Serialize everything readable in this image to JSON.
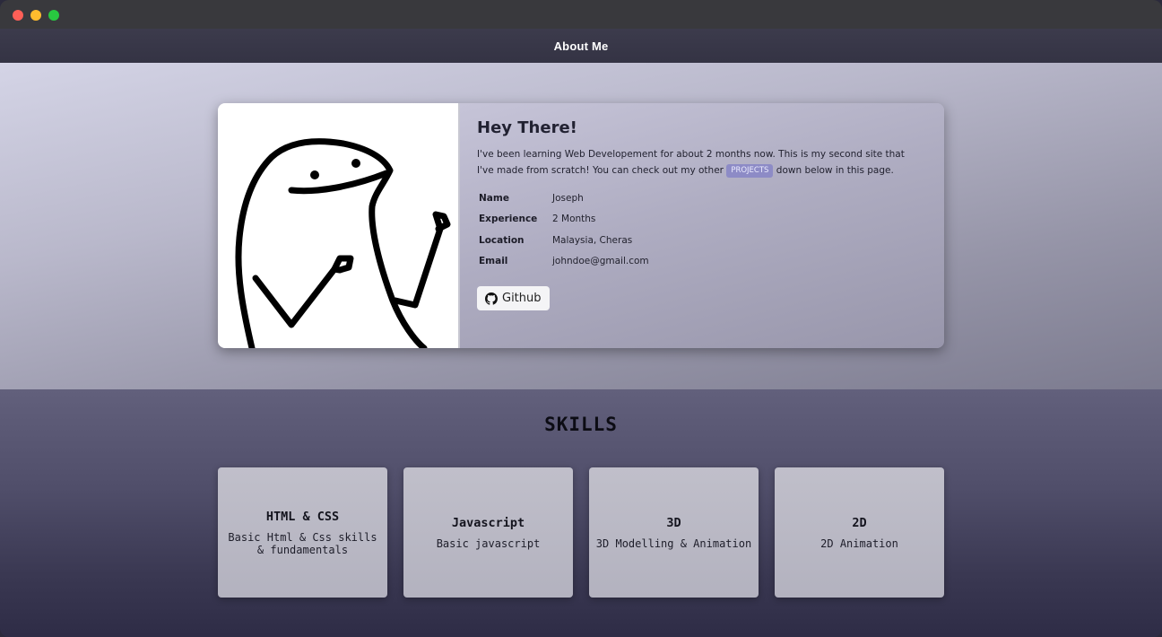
{
  "window": {
    "traffic_lights": [
      "close",
      "minimize",
      "zoom"
    ]
  },
  "navbar": {
    "title": "About Me"
  },
  "profile": {
    "heading": "Hey There!",
    "intro_before": "I've been learning Web Developement for about 2 months now. This is my second site that I've made from scratch! You can check out my other ",
    "projects_badge": "PROJECTS",
    "intro_after": " down below in this page.",
    "info": [
      {
        "key": "Name",
        "value": "Joseph"
      },
      {
        "key": "Experience",
        "value": "2 Months"
      },
      {
        "key": "Location",
        "value": "Malaysia, Cheras"
      },
      {
        "key": "Email",
        "value": "johndoe@gmail.com"
      }
    ],
    "github_label": "Github",
    "github_icon": "github-icon"
  },
  "skills": {
    "title": "SKILLS",
    "items": [
      {
        "name": "HTML & CSS",
        "desc": "Basic Html & Css skills & fundamentals"
      },
      {
        "name": "Javascript",
        "desc": "Basic javascript"
      },
      {
        "name": "3D",
        "desc": "3D Modelling & Animation"
      },
      {
        "name": "2D",
        "desc": "2D Animation"
      }
    ]
  },
  "colors": {
    "accent_badge": "#8d8bc6",
    "navbar": "#3c3b4c"
  }
}
